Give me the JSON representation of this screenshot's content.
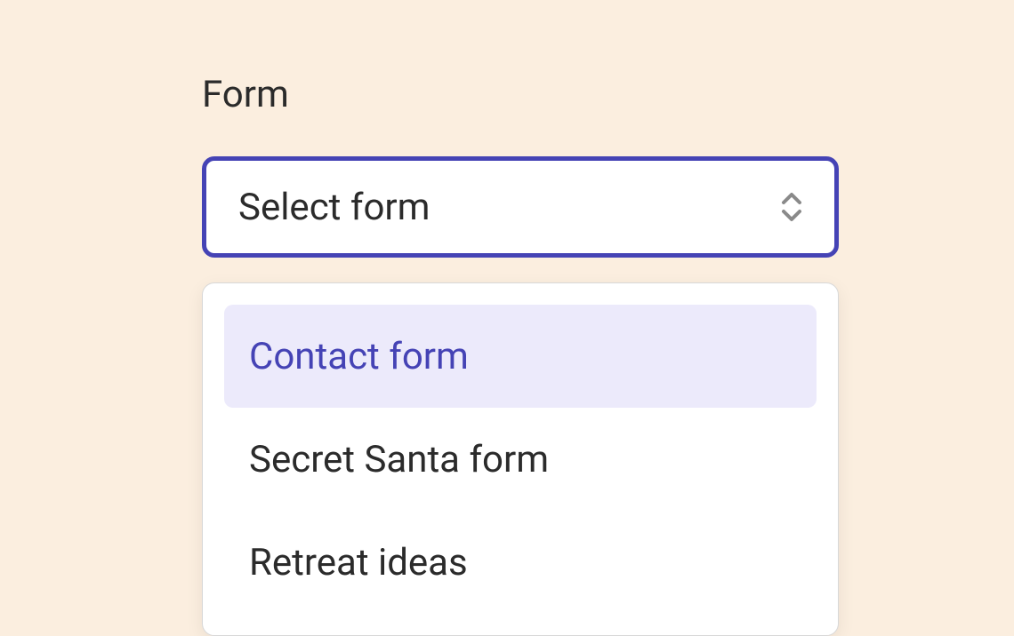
{
  "form": {
    "label": "Form",
    "select": {
      "placeholder": "Select form",
      "options": [
        {
          "label": "Contact form",
          "highlighted": true
        },
        {
          "label": "Secret Santa form",
          "highlighted": false
        },
        {
          "label": "Retreat ideas",
          "highlighted": false
        }
      ]
    }
  },
  "colors": {
    "background": "#fbeedf",
    "accent": "#4543b5",
    "highlight_bg": "#eceafb",
    "text": "#2b2b2b"
  }
}
